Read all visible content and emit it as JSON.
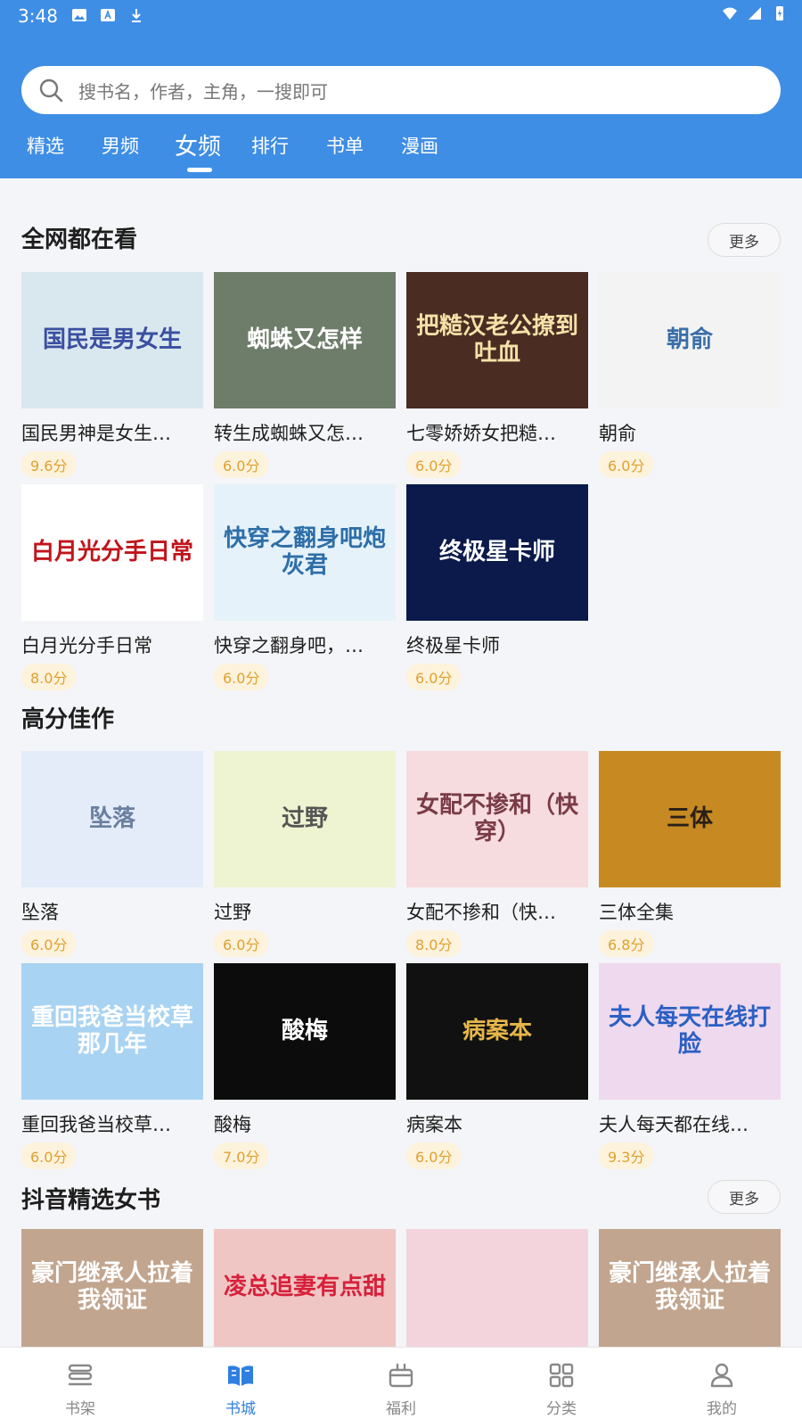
{
  "status": {
    "time": "3:48"
  },
  "search": {
    "placeholder": "搜书名，作者，主角，一搜即可"
  },
  "tabs": [
    {
      "label": "精选"
    },
    {
      "label": "男频"
    },
    {
      "label": "女频"
    },
    {
      "label": "排行"
    },
    {
      "label": "书单"
    },
    {
      "label": "漫画"
    }
  ],
  "sections": [
    {
      "title": "全网都在看",
      "more": "更多",
      "books": [
        {
          "title": "国民男神是女生…",
          "score": "9.6分",
          "cover_text": "国民是男女生",
          "cover_bg": "#d9e8ef",
          "cover_fg": "#3b4fa0"
        },
        {
          "title": "转生成蜘蛛又怎…",
          "score": "6.0分",
          "cover_text": "蜘蛛又怎样",
          "cover_bg": "#6e7c6a",
          "cover_fg": "#ffffff"
        },
        {
          "title": "七零娇娇女把糙…",
          "score": "6.0分",
          "cover_text": "把糙汉老公撩到吐血",
          "cover_bg": "#4a2c22",
          "cover_fg": "#f5e2a8"
        },
        {
          "title": "朝俞",
          "score": "6.0分",
          "cover_text": "朝俞",
          "cover_bg": "#f3f3f3",
          "cover_fg": "#3a6fa8"
        },
        {
          "title": "白月光分手日常",
          "score": "8.0分",
          "cover_text": "白月光分手日常",
          "cover_bg": "#ffffff",
          "cover_fg": "#c0141b"
        },
        {
          "title": "快穿之翻身吧，…",
          "score": "6.0分",
          "cover_text": "快穿之翻身吧炮灰君",
          "cover_bg": "#e6f2fa",
          "cover_fg": "#2d6ea8"
        },
        {
          "title": "终极星卡师",
          "score": "6.0分",
          "cover_text": "终极星卡师",
          "cover_bg": "#0b1a4a",
          "cover_fg": "#ffffff"
        }
      ]
    },
    {
      "title": "高分佳作",
      "more": "",
      "books": [
        {
          "title": "坠落",
          "score": "6.0分",
          "cover_text": "坠落",
          "cover_bg": "#e3ecf8",
          "cover_fg": "#6a7fa0"
        },
        {
          "title": "过野",
          "score": "6.0分",
          "cover_text": "过野",
          "cover_bg": "#eef3d2",
          "cover_fg": "#555"
        },
        {
          "title": "女配不掺和（快…",
          "score": "8.0分",
          "cover_text": "女配不掺和（快穿）",
          "cover_bg": "#f6dcdf",
          "cover_fg": "#7a3b46"
        },
        {
          "title": "三体全集",
          "score": "6.8分",
          "cover_text": "三体",
          "cover_bg": "#c78a22",
          "cover_fg": "#2a2018"
        },
        {
          "title": "重回我爸当校草…",
          "score": "6.0分",
          "cover_text": "重回我爸当校草那几年",
          "cover_bg": "#a9d3f2",
          "cover_fg": "#ffffff"
        },
        {
          "title": "酸梅",
          "score": "7.0分",
          "cover_text": "酸梅",
          "cover_bg": "#0c0c0c",
          "cover_fg": "#ffffff"
        },
        {
          "title": "病案本",
          "score": "6.0分",
          "cover_text": "病案本",
          "cover_bg": "#111111",
          "cover_fg": "#e6b64a"
        },
        {
          "title": "夫人每天都在线…",
          "score": "9.3分",
          "cover_text": "夫人每天在线打脸",
          "cover_bg": "#efd9ee",
          "cover_fg": "#2a5fc4"
        }
      ]
    },
    {
      "title": "抖音精选女书",
      "more": "更多",
      "books": [
        {
          "title": "",
          "score": "",
          "cover_text": "豪门继承人拉着我领证",
          "cover_bg": "#c2a58e",
          "cover_fg": "#ffffff"
        },
        {
          "title": "",
          "score": "",
          "cover_text": "凌总追妻有点甜",
          "cover_bg": "#f0c6c4",
          "cover_fg": "#d8203a"
        },
        {
          "title": "",
          "score": "",
          "cover_text": "",
          "cover_bg": "#f3d4dc",
          "cover_fg": "#7a3b46"
        },
        {
          "title": "",
          "score": "",
          "cover_text": "豪门继承人拉着我领证",
          "cover_bg": "#c2a58e",
          "cover_fg": "#ffffff"
        }
      ]
    }
  ],
  "bottom_nav": [
    {
      "label": "书架",
      "icon": "bookshelf-icon"
    },
    {
      "label": "书城",
      "icon": "book-open-icon"
    },
    {
      "label": "福利",
      "icon": "gift-icon"
    },
    {
      "label": "分类",
      "icon": "grid-icon"
    },
    {
      "label": "我的",
      "icon": "user-icon"
    }
  ],
  "colors": {
    "accent": "#3f8ee5",
    "nav_active": "#2f7fe0",
    "score_text": "#e0a030",
    "score_bg": "#fdf3dc"
  }
}
